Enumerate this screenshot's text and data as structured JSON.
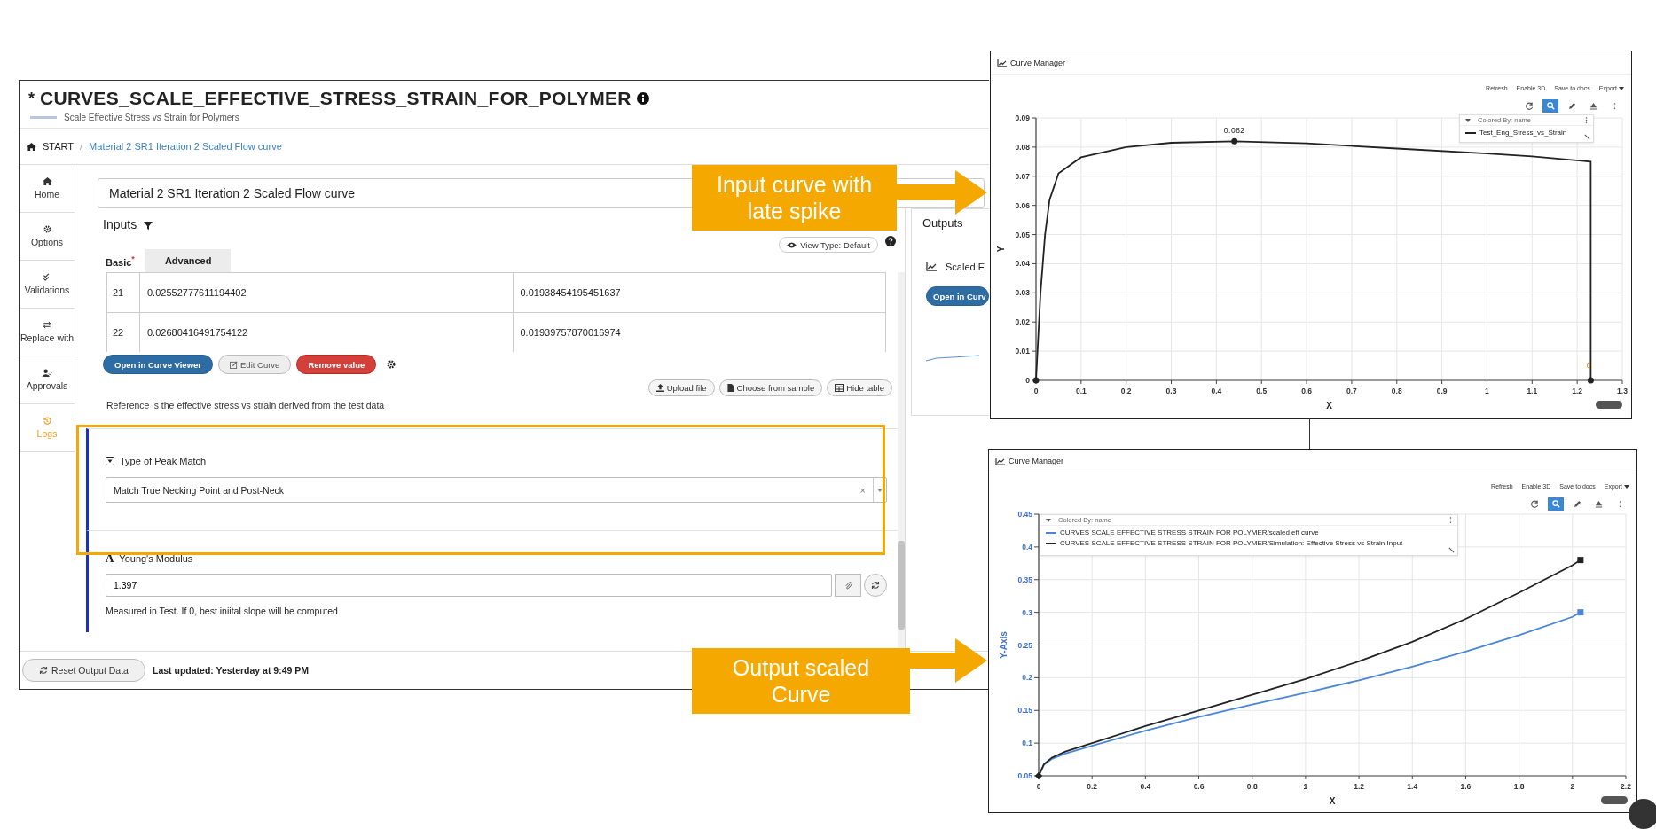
{
  "app": {
    "title_prefix": "*",
    "title": "CURVES_SCALE_EFFECTIVE_STRESS_STRAIN_FOR_POLYMER",
    "subtitle": "Scale Effective Stress vs Strain for Polymers",
    "breadcrumb": [
      "START",
      "Material 2 SR1 Iteration 2 Scaled Flow curve"
    ],
    "breadcrumb_separator": "/",
    "sidebar": [
      {
        "label": "Home",
        "selected": false
      },
      {
        "label": "Options",
        "selected": false
      },
      {
        "label": "Validations",
        "selected": false
      },
      {
        "label": "Replace with",
        "selected": false
      },
      {
        "label": "Approvals",
        "selected": false
      },
      {
        "label": "Logs",
        "selected": true
      }
    ],
    "name_field": {
      "value": "Material 2 SR1 Iteration 2 Scaled Flow curve"
    },
    "inputs": {
      "title": "Inputs",
      "view_type": "View Type: Default",
      "tabs": [
        {
          "label": "Basic",
          "badge": "*",
          "selected": true
        },
        {
          "label": "Advanced",
          "selected": false
        }
      ],
      "table_rows": [
        {
          "index": "21",
          "cells": [
            "0.02552777611194402",
            "0.01938454195451637"
          ]
        },
        {
          "index": "22",
          "cells": [
            "0.02680416491754122",
            "0.01939757870016974"
          ]
        }
      ],
      "buttons": [
        {
          "label": "Open in Curve Viewer",
          "kind": "primary"
        },
        {
          "label": "Edit Curve",
          "kind": "default"
        },
        {
          "label": "Remove value",
          "kind": "danger"
        }
      ],
      "file_buttons": [
        "Upload file",
        "Choose from sample",
        "Hide table"
      ],
      "description": "Reference is the effective stress vs strain derived from the test data",
      "peak_match": {
        "label": "Type of Peak Match",
        "value": "Match True Necking Point and Post-Neck",
        "clear": "×"
      },
      "youngs": {
        "glyph": "A",
        "label": "Young's Modulus",
        "value": "1.397",
        "help": "Measured in Test. If 0, best iniital slope will be computed"
      }
    },
    "outputs": {
      "title": "Outputs",
      "item": "Scaled E",
      "button": "Open in Curv"
    },
    "footer": {
      "reset": "Reset Output Data",
      "updated": "Last updated: Yesterday at 9:49 PM"
    }
  },
  "callouts": [
    {
      "text": "Input curve with late spike"
    },
    {
      "text": "Output scaled Curve"
    }
  ],
  "top_chart": {
    "title": "Curve Manager",
    "toolbar": [
      "Refresh",
      "Enable 3D",
      "Save to docs",
      "Export"
    ],
    "tools": [
      {
        "selected": false
      },
      {
        "selected": true
      },
      {
        "selected": false
      },
      {
        "selected": false
      },
      {
        "selected": false
      }
    ],
    "legend_header": "Colored By: name",
    "chart_data": {
      "type": "line",
      "grid": true,
      "xlabel": "X",
      "ylabel": "Y",
      "xlim": [
        0,
        1.3
      ],
      "ylim": [
        0,
        0.09
      ],
      "xticks": [
        0,
        0.1,
        0.2,
        0.3,
        0.4,
        0.5,
        0.6,
        0.7,
        0.8,
        0.9,
        1,
        1.1,
        1.2,
        1.3
      ],
      "yticks": [
        0,
        0.01,
        0.02,
        0.03,
        0.04,
        0.05,
        0.06,
        0.07,
        0.08,
        0.09
      ],
      "x": [
        0,
        0.01,
        0.02,
        0.03,
        0.05,
        0.1,
        0.2,
        0.3,
        0.44,
        0.6,
        0.8,
        1,
        1.1,
        1.23,
        1.23
      ],
      "series": [
        {
          "name": "Test_Eng_Stress_vs_Strain",
          "color": "#222222",
          "values": [
            0,
            0.03,
            0.05,
            0.062,
            0.071,
            0.0765,
            0.08,
            0.0815,
            0.082,
            0.0813,
            0.0795,
            0.0778,
            0.0768,
            0.075,
            0
          ]
        }
      ],
      "annotations": [
        {
          "x": 0.44,
          "y": 0.082,
          "text": "0.082"
        },
        {
          "x": 1.23,
          "y": 0.003,
          "text": "0"
        }
      ]
    }
  },
  "bottom_chart": {
    "title": "Curve Manager",
    "toolbar": [
      "Refresh",
      "Enable 3D",
      "Save to docs",
      "Export"
    ],
    "tools": [
      {
        "selected": false
      },
      {
        "selected": true
      },
      {
        "selected": false
      },
      {
        "selected": false
      },
      {
        "selected": false
      }
    ],
    "legend_header": "Colored By: name",
    "chart_data": {
      "type": "line",
      "grid": true,
      "xlabel": "X",
      "ylabel": "Y-Axis",
      "xlim": [
        0,
        2.2
      ],
      "ylim": [
        0.05,
        0.45
      ],
      "xticks": [
        0,
        0.2,
        0.4,
        0.6,
        0.8,
        1,
        1.2,
        1.4,
        1.6,
        1.8,
        2,
        2.2
      ],
      "yticks": [
        0.05,
        0.1,
        0.15,
        0.2,
        0.25,
        0.3,
        0.35,
        0.4,
        0.45
      ],
      "x": [
        0,
        0.02,
        0.05,
        0.1,
        0.2,
        0.4,
        0.6,
        0.8,
        1,
        1.2,
        1.4,
        1.6,
        1.8,
        2,
        2.03
      ],
      "series": [
        {
          "name": "CURVES SCALE EFFECTIVE STRESS STRAIN FOR POLYMER/scaled eff curve",
          "color": "#4a86d8",
          "values": [
            0.05,
            0.067,
            0.076,
            0.084,
            0.096,
            0.119,
            0.14,
            0.159,
            0.177,
            0.196,
            0.217,
            0.24,
            0.265,
            0.293,
            0.3
          ]
        },
        {
          "name": "CURVES SCALE EFFECTIVE STRESS STRAIN FOR POLYMER/Simulation: Effective Stress vs Strain Input",
          "color": "#222222",
          "values": [
            0.05,
            0.068,
            0.078,
            0.087,
            0.1,
            0.126,
            0.15,
            0.174,
            0.198,
            0.225,
            0.255,
            0.29,
            0.33,
            0.372,
            0.38
          ]
        }
      ]
    }
  }
}
